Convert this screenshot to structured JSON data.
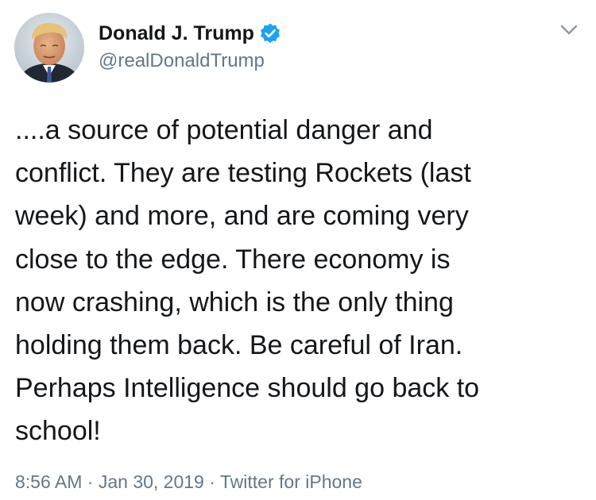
{
  "author": {
    "display_name": "Donald J. Trump",
    "handle": "@realDonaldTrump",
    "verified": true,
    "avatar_icon": "profile-photo"
  },
  "menu": {
    "icon": "chevron-down-icon"
  },
  "tweet": {
    "lines": [
      "....a source of potential danger and",
      "conflict. They are testing Rockets (last",
      "week) and more, and are coming very",
      "close to the edge. There economy is",
      "now crashing, which is the only thing",
      "holding them back. Be careful of Iran.",
      "Perhaps Intelligence should go back to",
      "school!"
    ]
  },
  "meta": {
    "time": "8:56 AM",
    "separator": " · ",
    "date": "Jan 30, 2019",
    "source": "Twitter for iPhone"
  },
  "colors": {
    "text": "#14171a",
    "secondary": "#657786",
    "verified_blue": "#1da1f2"
  }
}
